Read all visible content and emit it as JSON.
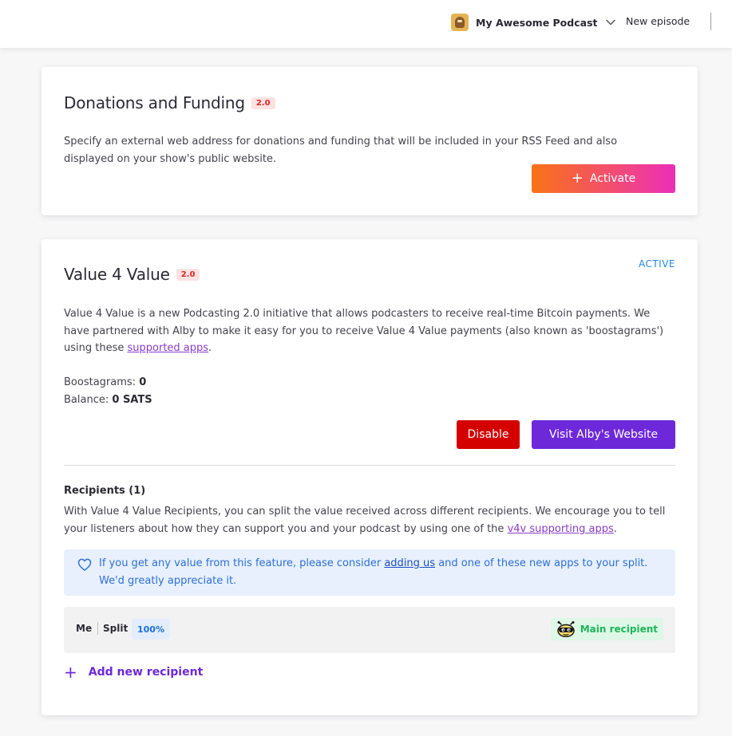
{
  "header": {
    "podcast_name": "My Awesome Podcast",
    "new_episode_label": "New episode",
    "icons": {
      "logo": "podcast-logo",
      "dropdown": "chevron-down-icon"
    }
  },
  "donations": {
    "title": "Donations and Funding",
    "badge": "2.0",
    "description": "Specify an external web address for donations and funding that will be included in your RSS Feed and also displayed on your show's public website.",
    "activate_label": "Activate"
  },
  "v4v": {
    "title": "Value 4 Value",
    "badge": "2.0",
    "status": "ACTIVE",
    "description_before": "Value 4 Value is a new Podcasting 2.0 initiative that allows podcasters to receive real-time Bitcoin payments. We have partnered with Alby to make it easy for you to receive Value 4 Value payments (also known as 'boostagrams') using these ",
    "description_link": "supported apps",
    "description_after": ".",
    "boostagrams_label": "Boostagrams:",
    "boostagrams_value": "0",
    "balance_label": "Balance:",
    "balance_value": "0 SATS",
    "disable_label": "Disable",
    "visit_label": "Visit Alby's Website"
  },
  "recipients": {
    "title": "Recipients (1)",
    "description_before": "With Value 4 Value Recipients, you can split the value received across different recipients. We encourage you to tell your listeners about how they can support you and your podcast by using one of the ",
    "description_link": "v4v supporting apps",
    "description_after": ".",
    "notice_before": "If you get any value from this feature, please consider ",
    "notice_link": "adding us",
    "notice_after": " and one of these new apps to your split. We'd greatly appreciate it.",
    "rows": [
      {
        "name": "Me",
        "split_label": "Split",
        "split_value": "100%",
        "badge": "Main recipient"
      }
    ],
    "add_label": "Add new recipient"
  },
  "colors": {
    "accent_purple": "#6d28d9",
    "danger_red": "#d40000",
    "active_blue": "#1e88e5",
    "success_green": "#1fb55a"
  }
}
